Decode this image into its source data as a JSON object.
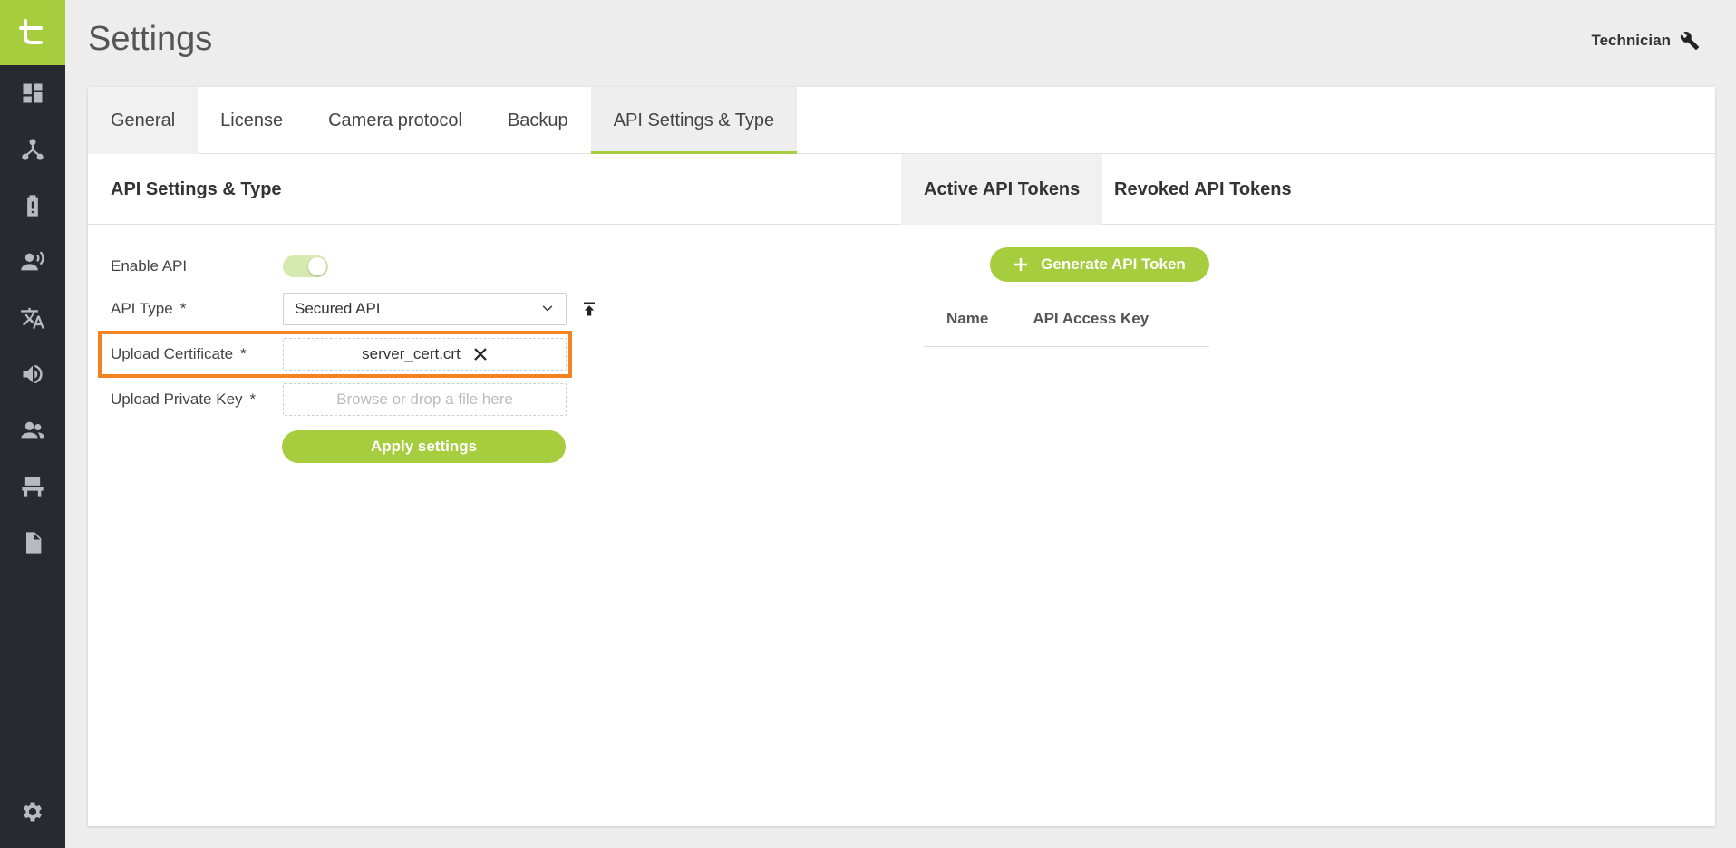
{
  "app": {
    "page_title": "Settings",
    "user_label": "Technician",
    "user_icon": "wrench-icon"
  },
  "sidebar": {
    "logo_icon": "brand-logo-icon",
    "items": [
      {
        "name": "dashboard",
        "icon": "dashboard-icon"
      },
      {
        "name": "network",
        "icon": "network-icon"
      },
      {
        "name": "alerts",
        "icon": "alert-battery-icon"
      },
      {
        "name": "voice",
        "icon": "speaker-person-icon"
      },
      {
        "name": "translation",
        "icon": "translate-icon"
      },
      {
        "name": "audio",
        "icon": "volume-icon"
      },
      {
        "name": "users",
        "icon": "users-icon"
      },
      {
        "name": "seating",
        "icon": "chair-icon"
      },
      {
        "name": "documents",
        "icon": "document-icon"
      }
    ],
    "settings_icon": "gear-icon"
  },
  "tabs": [
    "General",
    "License",
    "Camera protocol",
    "Backup",
    "API Settings & Type"
  ],
  "active_tab": "API Settings & Type",
  "section": {
    "title": "API Settings & Type",
    "subtabs": [
      "Active API Tokens",
      "Revoked API Tokens"
    ],
    "active_subtab": "Active API Tokens"
  },
  "form": {
    "enable_api_label": "Enable API",
    "enable_api_value": true,
    "api_type_label": "API Type",
    "api_type_value": "Secured API",
    "required_mark": "*",
    "upload_cert_label": "Upload Certificate",
    "upload_cert_file": "server_cert.crt",
    "upload_key_label": "Upload Private Key",
    "upload_key_placeholder": "Browse or drop a file here",
    "apply_label": "Apply settings"
  },
  "tokens": {
    "generate_label": "Generate API Token",
    "columns": [
      "Name",
      "API Access Key"
    ]
  },
  "colors": {
    "accent": "#a6cd3e",
    "sidebar": "#272b30",
    "highlight": "#f58220"
  }
}
